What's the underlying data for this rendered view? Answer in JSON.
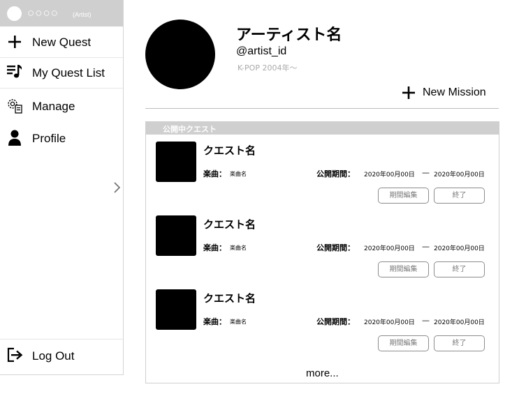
{
  "sidebar": {
    "user": {
      "name": "○○○○",
      "role": "(Artist)"
    },
    "items": [
      {
        "label": "New Quest",
        "icon": "plus-icon"
      },
      {
        "label": "My Quest List",
        "icon": "music-list-icon"
      },
      {
        "label": "Manage",
        "icon": "gear-document-icon"
      },
      {
        "label": "Profile",
        "icon": "person-icon"
      }
    ],
    "logout": {
      "label": "Log Out",
      "icon": "logout-icon"
    },
    "collapse_icon": "chevron-right-icon"
  },
  "profile": {
    "name": "アーティスト名",
    "handle": "@artist_id",
    "genre": "K-POP 2004年〜"
  },
  "actions": {
    "new_mission_label": "New Mission"
  },
  "quest_panel": {
    "title": "公開中クエスト",
    "quests": [
      {
        "name": "クエスト名",
        "song_label": "楽曲：",
        "song_value": "楽曲名",
        "period_label": "公開期間：",
        "start": "2020年00月00日",
        "dash": "—",
        "end": "2020年00月00日",
        "edit_label": "期間編集",
        "end_label": "終了"
      },
      {
        "name": "クエスト名",
        "song_label": "楽曲：",
        "song_value": "楽曲名",
        "period_label": "公開期間：",
        "start": "2020年00月00日",
        "dash": "—",
        "end": "2020年00月00日",
        "edit_label": "期間編集",
        "end_label": "終了"
      },
      {
        "name": "クエスト名",
        "song_label": "楽曲：",
        "song_value": "楽曲名",
        "period_label": "公開期間：",
        "start": "2020年00月00日",
        "dash": "—",
        "end": "2020年00月00日",
        "edit_label": "期間編集",
        "end_label": "終了"
      }
    ],
    "more_label": "more..."
  },
  "colors": {
    "sidebar_header_bg": "#cfcfcf",
    "panel_title_bg": "#cfcfcf",
    "muted_text": "#aaaaaa",
    "button_border": "#8c8c8c"
  }
}
